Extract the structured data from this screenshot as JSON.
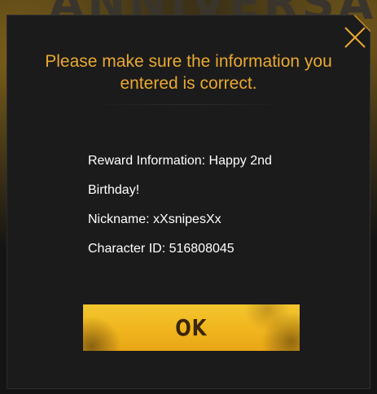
{
  "dialog": {
    "heading": "Please make sure the information you entered is correct.",
    "close_icon": "close-icon",
    "info": {
      "reward_line1": "Reward Information: Happy 2nd",
      "reward_line2": "Birthday!",
      "nickname": "Nickname: xXsnipesXx",
      "character_id": "Character ID: 516808045"
    },
    "ok_label": "OK"
  },
  "colors": {
    "accent": "#e9a92f",
    "button": "#f1b51d",
    "panel": "#1b1b1b"
  }
}
